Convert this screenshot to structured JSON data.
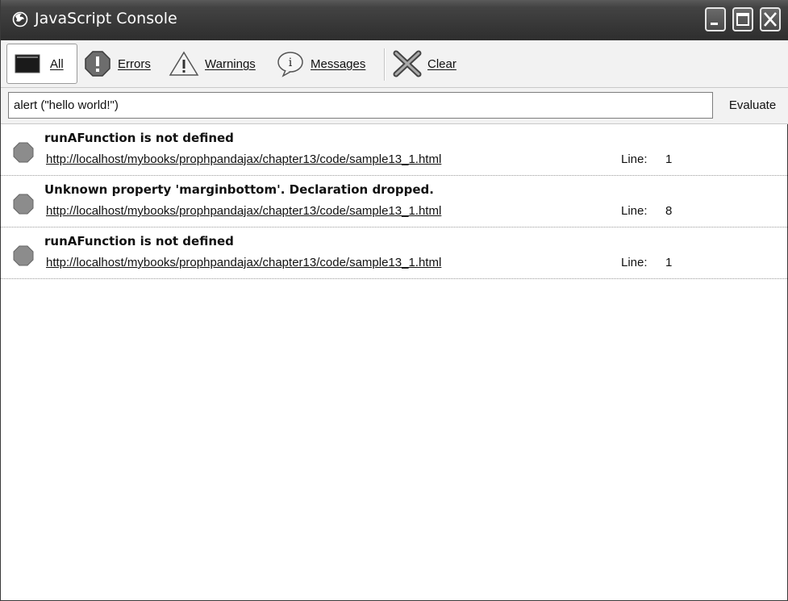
{
  "window": {
    "title": "JavaScript Console",
    "icon": "firefox-icon"
  },
  "toolbar": {
    "all_label": "All",
    "errors_label": "Errors",
    "warnings_label": "Warnings",
    "messages_label": "Messages",
    "clear_label": "Clear",
    "selected": "All"
  },
  "eval": {
    "input_value": "alert (\"hello world!\")",
    "button_label": "Evaluate"
  },
  "messages": [
    {
      "text": "runAFunction is not defined",
      "source": "http://localhost/mybooks/prophpandajax/chapter13/code/sample13_1.html",
      "line_label": "Line:",
      "line": "1"
    },
    {
      "text": "Unknown property 'marginbottom'. Declaration dropped.",
      "source": "http://localhost/mybooks/prophpandajax/chapter13/code/sample13_1.html",
      "line_label": "Line:",
      "line": "8"
    },
    {
      "text": "runAFunction is not defined",
      "source": "http://localhost/mybooks/prophpandajax/chapter13/code/sample13_1.html",
      "line_label": "Line:",
      "line": "1"
    }
  ]
}
